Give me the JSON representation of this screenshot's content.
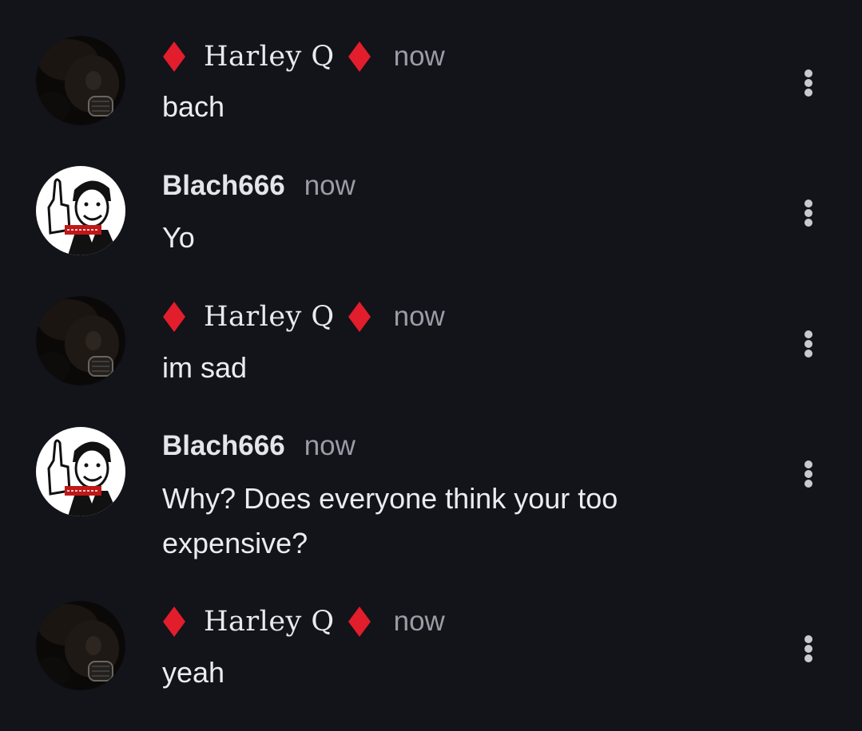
{
  "messages": [
    {
      "author": "Harley Q",
      "style": "harley",
      "time": "now",
      "text": "bach"
    },
    {
      "author": "Blach666",
      "style": "blach",
      "time": "now",
      "text": "Yo"
    },
    {
      "author": "Harley Q",
      "style": "harley",
      "time": "now",
      "text": "im sad"
    },
    {
      "author": "Blach666",
      "style": "blach",
      "time": "now",
      "text": "Why? Does everyone think your too expensive?"
    },
    {
      "author": "Harley Q",
      "style": "harley",
      "time": "now",
      "text": "yeah"
    }
  ],
  "icons": {
    "author_decoration": "red-diamond-icon",
    "message_menu": "more-vertical-icon"
  },
  "colors": {
    "background": "#13131a",
    "diamond": "#e21d2c",
    "time": "#9c9ca6"
  }
}
